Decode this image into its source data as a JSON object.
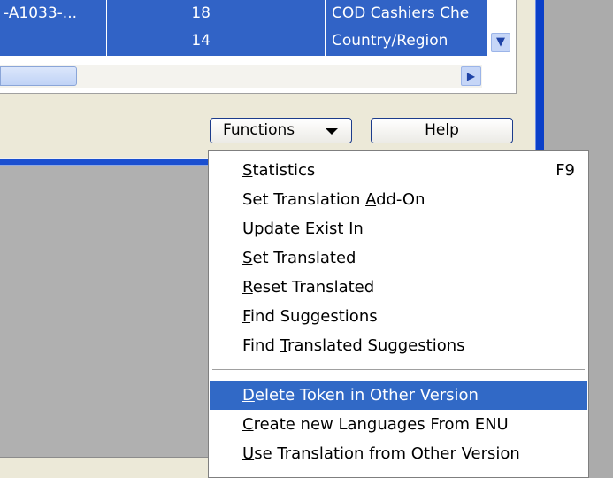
{
  "table": {
    "rows": [
      {
        "c1": "-A1033-...",
        "c2": "18",
        "c3": "",
        "c4": "COD Cashiers Che"
      },
      {
        "c1": "",
        "c2": "14",
        "c3": "",
        "c4": "Country/Region"
      }
    ]
  },
  "buttons": {
    "functions_label": "Functions",
    "help_label": "Help"
  },
  "menu": {
    "items": [
      {
        "label": "Statistics",
        "shortcut": "F9",
        "underline_index": 0
      },
      {
        "label": "Set Translation Add-On",
        "underline_index": 16
      },
      {
        "label": "Update Exist In",
        "underline_index": 7
      },
      {
        "label": "Set Translated",
        "underline_index": 0
      },
      {
        "label": "Reset Translated",
        "underline_index": 0
      },
      {
        "label": "Find Suggestions",
        "underline_index": 0
      },
      {
        "label": "Find Translated Suggestions",
        "underline_index": 5
      },
      {
        "label": "Delete Token in Other Version",
        "underline_index": 0,
        "highlighted": true
      },
      {
        "label": "Create new Languages From ENU",
        "underline_index": 0
      },
      {
        "label": "Use Translation from Other Version",
        "underline_index": 0
      }
    ]
  },
  "icons": {
    "dropdown_arrow": "chevron-down-icon",
    "scroll_down": "scroll-down-icon",
    "scroll_right": "scroll-right-icon"
  },
  "colors": {
    "selection": "#3163c6",
    "menu_highlight": "#3169c6",
    "window_edge": "#0a3fc9"
  }
}
